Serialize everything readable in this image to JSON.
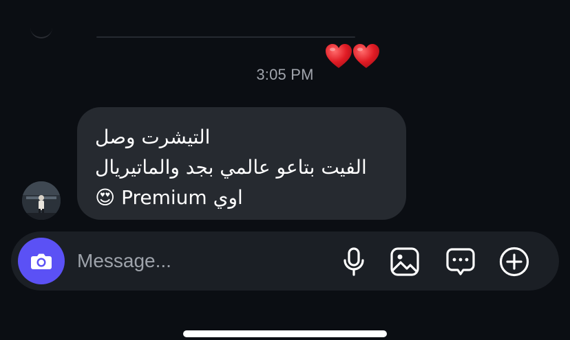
{
  "conversation": {
    "reaction": "❤️❤️",
    "timestamp": "3:05 PM",
    "message": {
      "line1": "التيشرت وصل",
      "line2": "الفيت بتاعو عالمي بجد والماتيريال",
      "line3_prefix": "Premium اوي",
      "line3_emoji": "😍"
    }
  },
  "composer": {
    "placeholder": "Message...",
    "value": "",
    "icons": [
      "camera-icon",
      "microphone-icon",
      "gallery-icon",
      "sticker-icon",
      "plus-icon"
    ]
  },
  "colors": {
    "background": "#0b0e13",
    "bubble": "#262a30",
    "composer": "#1b1f25",
    "camera_button": "#5b51f5",
    "timestamp": "#a1a5ad"
  }
}
